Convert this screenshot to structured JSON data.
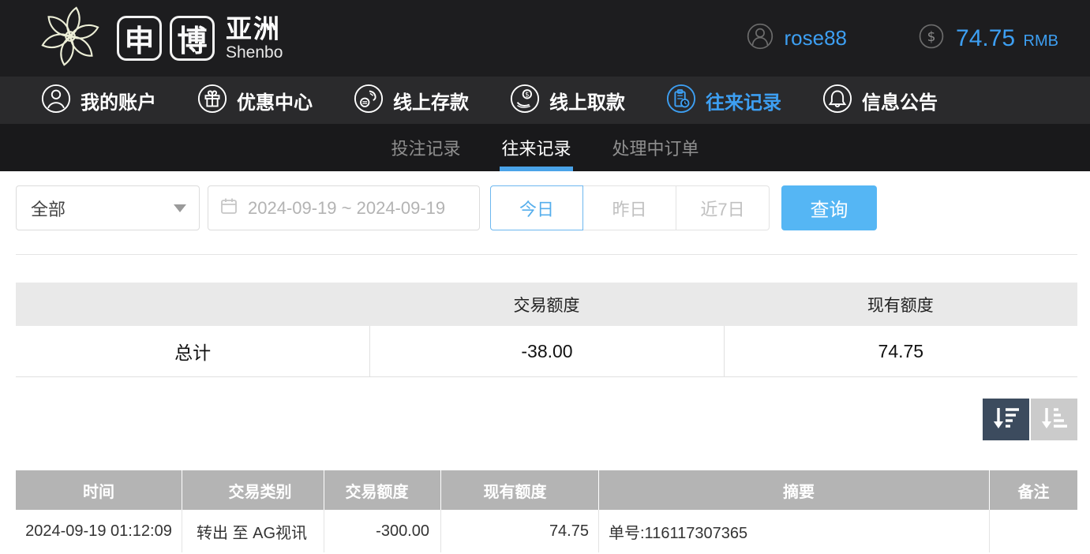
{
  "brand": {
    "char1": "申",
    "char2": "博",
    "region": "亚洲",
    "subtitle": "Shenbo"
  },
  "userbar": {
    "username": "rose88",
    "balance": "74.75",
    "currency": "RMB"
  },
  "nav": {
    "items": [
      {
        "label": "我的账户",
        "icon": "user-icon",
        "active": false
      },
      {
        "label": "优惠中心",
        "icon": "gift-icon",
        "active": false
      },
      {
        "label": "线上存款",
        "icon": "deposit-icon",
        "active": false
      },
      {
        "label": "线上取款",
        "icon": "withdraw-icon",
        "active": false
      },
      {
        "label": "往来记录",
        "icon": "records-icon",
        "active": true
      },
      {
        "label": "信息公告",
        "icon": "bell-icon",
        "active": false
      }
    ]
  },
  "subnav": {
    "tabs": [
      {
        "label": "投注记录",
        "active": false
      },
      {
        "label": "往来记录",
        "active": true
      },
      {
        "label": "处理中订单",
        "active": false
      }
    ]
  },
  "filters": {
    "type_select": {
      "value": "全部"
    },
    "date_range": {
      "value": "2024-09-19 ~ 2024-09-19"
    },
    "quick_buttons": [
      {
        "label": "今日",
        "active": true
      },
      {
        "label": "昨日",
        "active": false
      },
      {
        "label": "近7日",
        "active": false
      }
    ],
    "query_label": "查询"
  },
  "summary_table": {
    "headers": [
      "",
      "交易额度",
      "现有额度"
    ],
    "row": [
      "总计",
      "-38.00",
      "74.75"
    ]
  },
  "records_table": {
    "headers": [
      "时间",
      "交易类别",
      "交易额度",
      "现有额度",
      "摘要",
      "备注"
    ],
    "rows": [
      [
        "2024-09-19 01:12:09",
        "转出 至 AG视讯",
        "-300.00",
        "74.75",
        "单号:116117307365",
        ""
      ]
    ]
  },
  "colors": {
    "accent_blue": "#3d9ff2",
    "query_button_blue": "#55b6f4",
    "active_tab_underline": "#4aa3e8",
    "header_bg": "#1d1d1f",
    "nav_bg": "#2a2a2c",
    "subnav_bg": "#19191b",
    "summary_header_bg": "#e9e9e9",
    "records_header_bg": "#b4b4b4",
    "sort_desc_bg": "#3c4b5e",
    "sort_asc_bg": "#cbcbcb"
  }
}
